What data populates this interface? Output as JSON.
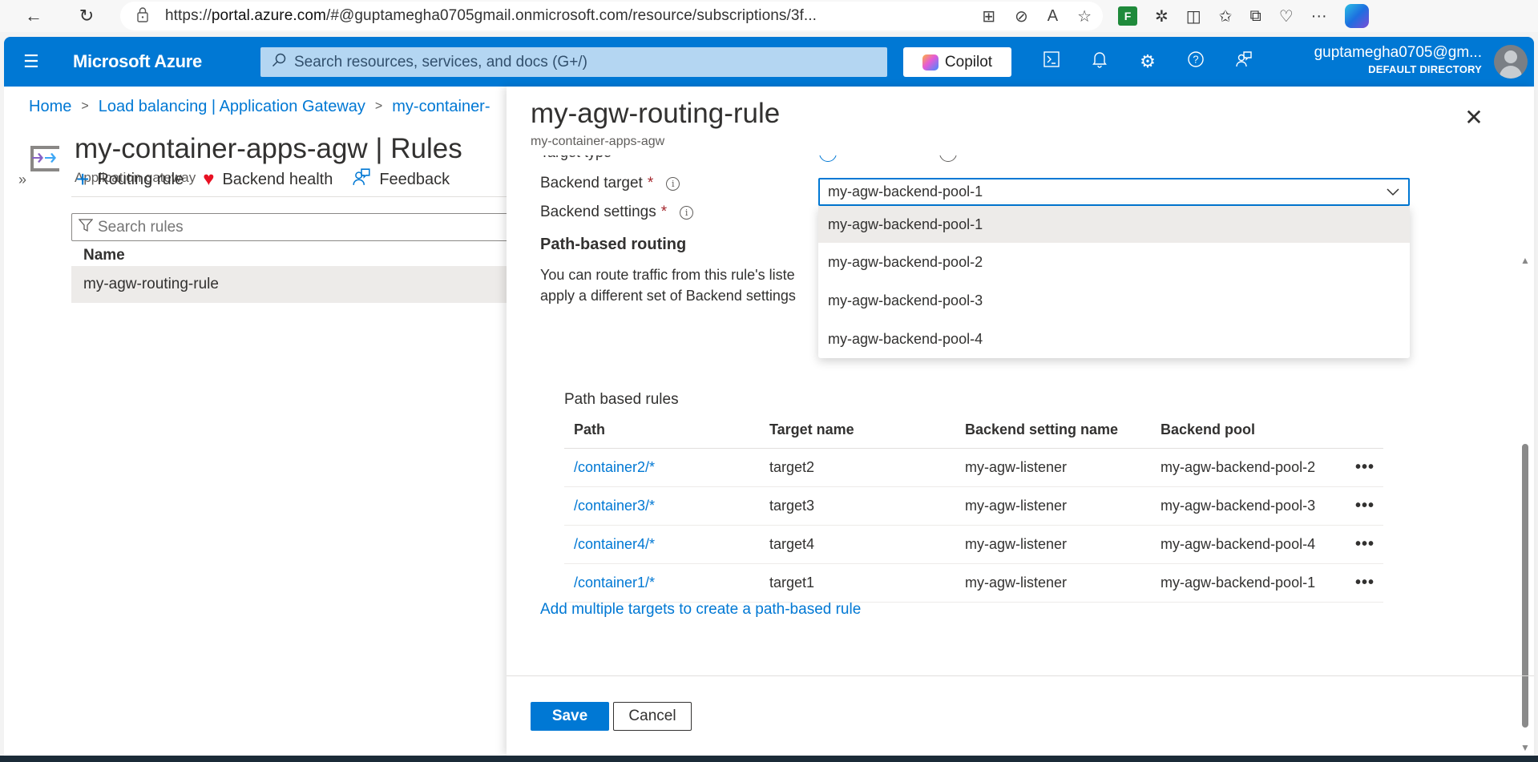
{
  "browser": {
    "url_prefix": "https://",
    "url_host": "portal.azure.com",
    "url_rest": "/#@guptamegha0705gmail.onmicrosoft.com/resource/subscriptions/3f...",
    "icons": {
      "back": "←",
      "refresh": "↻",
      "lock": "🔒",
      "app_available": "⊞",
      "tracking": "⊘",
      "read_aloud": "A",
      "favorite": "☆",
      "extension_green": "F",
      "extensions": "✲",
      "split_screen": "◫",
      "favorites": "✩",
      "collections": "⧉",
      "browser_essentials": "♡",
      "more": "···"
    }
  },
  "azure": {
    "brand": "Microsoft Azure",
    "search_placeholder": "Search resources, services, and docs (G+/)",
    "copilot_label": "Copilot",
    "user_name": "guptamegha0705@gm...",
    "user_directory": "DEFAULT DIRECTORY",
    "icons": {
      "menu": "☰",
      "search": "⚲",
      "cloud_shell": "⌨",
      "notifications": "🔔",
      "settings": "⚙",
      "help": "?",
      "feedback": "☺"
    }
  },
  "page": {
    "breadcrumb": [
      "Home",
      "Load balancing | Application Gateway",
      "my-container-"
    ],
    "breadcrumb_sep": ">",
    "title": "my-container-apps-agw | Rules",
    "subtitle": "Application gateway",
    "expand_icon": "»",
    "commands": [
      {
        "icon": "+",
        "label": "Routing rule"
      },
      {
        "icon": "♥",
        "label": "Backend health"
      },
      {
        "icon": "⚐",
        "label": "Feedback"
      }
    ],
    "search_placeholder": "Search rules",
    "filter_icon": "▽",
    "column_name": "Name",
    "rules": [
      "my-agw-routing-rule"
    ]
  },
  "panel": {
    "title": "my-agw-routing-rule",
    "subtitle": "my-container-apps-agw",
    "close_icon": "✕",
    "target_type_label": "Target type",
    "backend_target_label": "Backend target",
    "backend_settings_label": "Backend settings",
    "required_mark": "*",
    "info_icon": "i",
    "backend_target_value": "my-agw-backend-pool-1",
    "chevron_icon": "⌄",
    "dropdown_options": [
      {
        "label": "my-agw-backend-pool-1",
        "selected": true
      },
      {
        "label": "my-agw-backend-pool-2",
        "selected": false
      },
      {
        "label": "my-agw-backend-pool-3",
        "selected": false
      },
      {
        "label": "my-agw-backend-pool-4",
        "selected": false
      }
    ],
    "path_routing_heading": "Path-based routing",
    "path_routing_desc_1": "You can route traffic from this rule's liste",
    "path_routing_desc_2": "apply a different set of Backend settings",
    "path_rules_title": "Path based rules",
    "path_rules_columns": [
      "Path",
      "Target name",
      "Backend setting name",
      "Backend pool"
    ],
    "path_rules": [
      {
        "path": "/container2/*",
        "target": "target2",
        "setting": "my-agw-listener",
        "pool": "my-agw-backend-pool-2"
      },
      {
        "path": "/container3/*",
        "target": "target3",
        "setting": "my-agw-listener",
        "pool": "my-agw-backend-pool-3"
      },
      {
        "path": "/container4/*",
        "target": "target4",
        "setting": "my-agw-listener",
        "pool": "my-agw-backend-pool-4"
      },
      {
        "path": "/container1/*",
        "target": "target1",
        "setting": "my-agw-listener",
        "pool": "my-agw-backend-pool-1"
      }
    ],
    "row_more_icon": "•••",
    "add_link": "Add multiple targets to create a path-based rule",
    "save_label": "Save",
    "cancel_label": "Cancel"
  }
}
